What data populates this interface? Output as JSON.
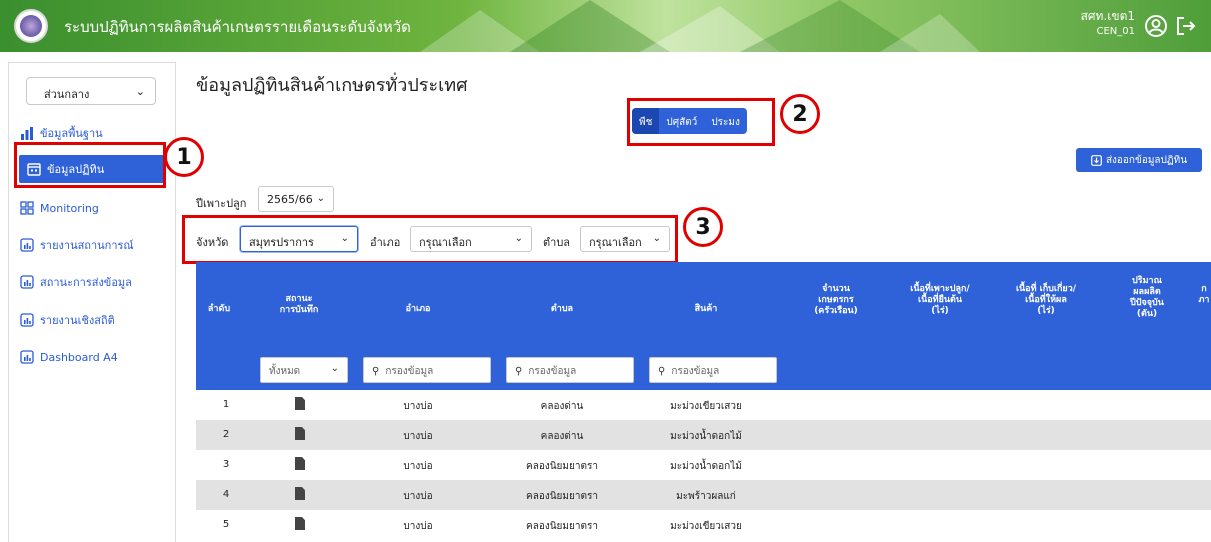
{
  "header": {
    "app_title": "ระบบปฏิทินการผลิตสินค้าเกษตรรายเดือนระดับจังหวัด",
    "user_name": "สศท.เขต1",
    "user_code": "CEN_01",
    "profile_icon": "user-circle-icon",
    "logout_icon": "logout-icon"
  },
  "sidebar": {
    "region_select": "ส่วนกลาง",
    "items": [
      {
        "label": "ข้อมูลพื้นฐาน",
        "icon": "bar-chart-icon"
      },
      {
        "label": "ข้อมูลปฏิทิน",
        "icon": "calendar-icon"
      },
      {
        "label": "Monitoring",
        "icon": "grid-icon"
      },
      {
        "label": "รายงานสถานการณ์",
        "icon": "report-icon"
      },
      {
        "label": "สถานะการส่งข้อมูล",
        "icon": "report-icon"
      },
      {
        "label": "รายงานเชิงสถิติ",
        "icon": "report-icon"
      },
      {
        "label": "Dashboard A4",
        "icon": "report-icon"
      }
    ]
  },
  "annotations": [
    "1",
    "2",
    "3"
  ],
  "main": {
    "title": "ข้อมูลปฏิทินสินค้าเกษตรทั่วประเทศ",
    "segments": [
      "พืช",
      "ปศุสัตว์",
      "ประมง"
    ],
    "active_segment": "พืช",
    "export_label": "ส่งออกข้อมูลปฏิทิน",
    "season_label": "ปีเพาะปลูก",
    "season_value": "2565/66",
    "filters": {
      "province_label": "จังหวัด",
      "province_value": "สมุทรปราการ",
      "district_label": "อำเภอ",
      "district_value": "กรุณาเลือก",
      "subdistrict_label": "ตำบล",
      "subdistrict_value": "กรุณาเลือก"
    }
  },
  "table": {
    "headers": {
      "seq": "ลำดับ",
      "status_1": "สถานะ",
      "status_2": "การบันทึก",
      "district": "อำเภอ",
      "subdistrict": "ตำบล",
      "product": "สินค้า",
      "households_1": "จำนวน",
      "households_2": "เกษตรกร",
      "households_3": "(ครัวเรือน)",
      "planted_1": "เนื้อที่เพาะปลูก/",
      "planted_2": "เนื้อที่ยืนต้น",
      "planted_3": "(ไร่)",
      "harvest_1": "เนื้อที่ เก็บเกี่ยว/",
      "harvest_2": "เนื้อที่ให้ผล",
      "harvest_3": "(ไร่)",
      "yield_1": "ปริมาณ",
      "yield_2": "ผลผลิต",
      "yield_3": "ปีปัจจุบัน",
      "yield_4": "(ตัน)",
      "cut_1": "ก",
      "cut_2": "ภา"
    },
    "filter_status": "ทั้งหมด",
    "filter_placeholder": "กรองข้อมูล",
    "rows": [
      {
        "seq": "1",
        "district": "บางบ่อ",
        "subdistrict": "คลองด่าน",
        "product": "มะม่วงเขียวเสวย"
      },
      {
        "seq": "2",
        "district": "บางบ่อ",
        "subdistrict": "คลองด่าน",
        "product": "มะม่วงน้ำดอกไม้"
      },
      {
        "seq": "3",
        "district": "บางบ่อ",
        "subdistrict": "คลองนิยมยาตรา",
        "product": "มะม่วงน้ำดอกไม้"
      },
      {
        "seq": "4",
        "district": "บางบ่อ",
        "subdistrict": "คลองนิยมยาตรา",
        "product": "มะพร้าวผลแก่"
      },
      {
        "seq": "5",
        "district": "บางบ่อ",
        "subdistrict": "คลองนิยมยาตรา",
        "product": "มะม่วงเขียวเสวย"
      }
    ]
  }
}
